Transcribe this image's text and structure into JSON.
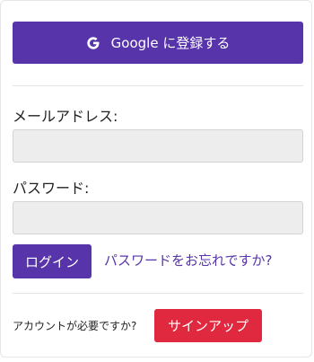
{
  "google_button": {
    "label": "Google に登録する",
    "icon": "google-icon"
  },
  "form": {
    "email_label": "メールアドレス:",
    "email_value": "",
    "password_label": "パスワード:",
    "password_value": "",
    "login_label": "ログイン",
    "forgot_label": "パスワードをお忘れですか?"
  },
  "footer": {
    "need_account_text": "アカウントが必要ですか?",
    "signup_label": "サインアップ"
  },
  "colors": {
    "primary": "#5734aa",
    "signup": "#e0283e",
    "input_bg": "#ededed"
  }
}
